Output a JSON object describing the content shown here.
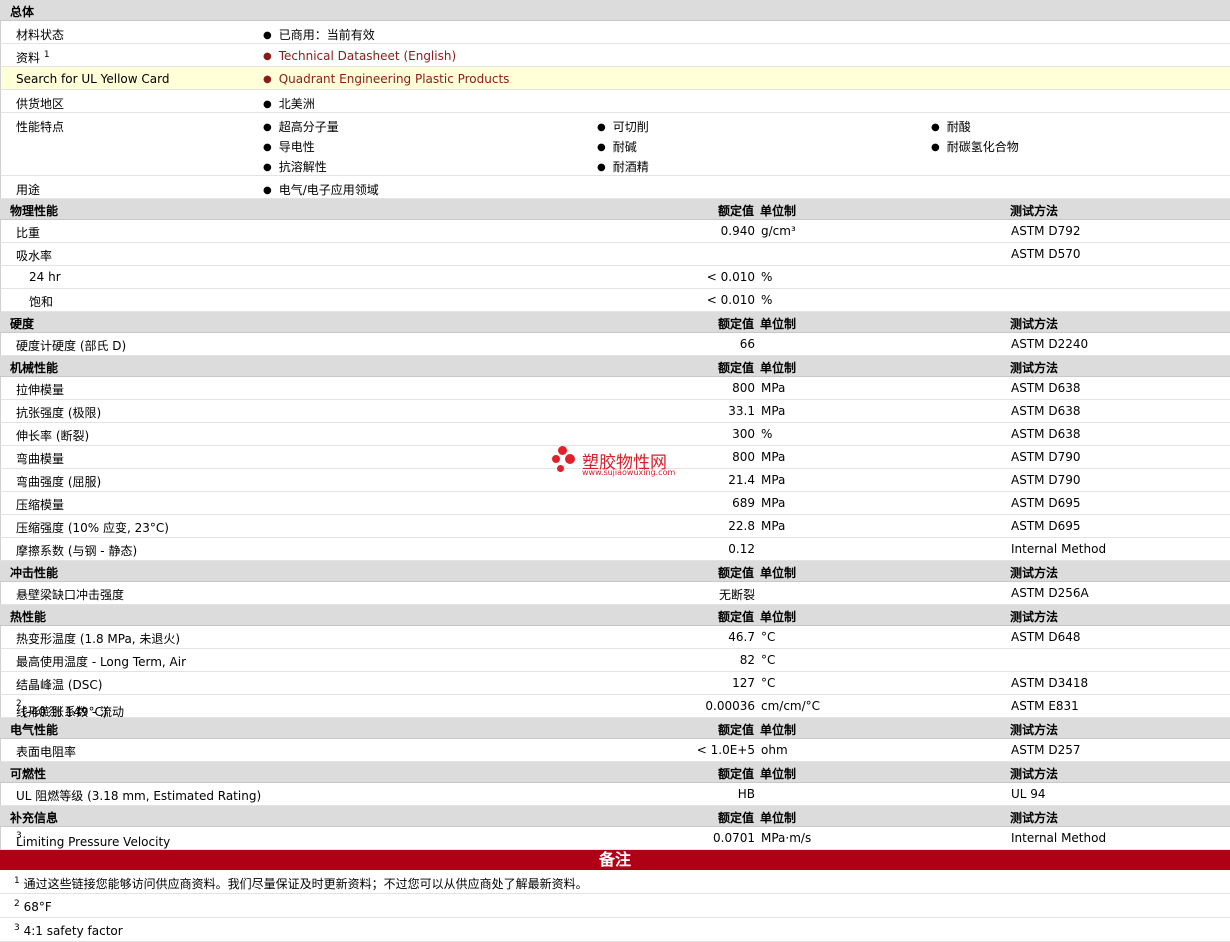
{
  "overview": {
    "title": "总体",
    "status_label": "材料状态",
    "status_value": "已商用：当前有效",
    "doc_label": "资料",
    "doc_sup": "1",
    "doc_link": "Technical Datasheet (English)",
    "ul_label": "Search for UL Yellow Card",
    "ul_link": "Quadrant Engineering Plastic Products",
    "region_label": "供货地区",
    "region_value": "北美洲",
    "features_label": "性能特点",
    "features": [
      "超高分子量",
      "导电性",
      "抗溶解性",
      "可切削",
      "耐碱",
      "耐酒精",
      "耐酸",
      "耐碳氢化合物"
    ],
    "use_label": "用途",
    "use_value": "电气/电子应用领域"
  },
  "columns": {
    "value": "额定值",
    "unit": "单位制",
    "method": "测试方法"
  },
  "sections": {
    "physical": {
      "title": "物理性能",
      "rows": [
        {
          "label": "比重",
          "value": "0.940",
          "unit": "g/cm³",
          "method": "ASTM D792"
        },
        {
          "label": "吸水率",
          "value": "",
          "unit": "",
          "method": "ASTM D570"
        },
        {
          "label": "24 hr",
          "value": "< 0.010",
          "unit": "%",
          "method": ""
        },
        {
          "label": "饱和",
          "value": "< 0.010",
          "unit": "%",
          "method": ""
        }
      ]
    },
    "hardness": {
      "title": "硬度",
      "rows": [
        {
          "label": "硬度计硬度 (部氏 D)",
          "value": "66",
          "unit": "",
          "method": "ASTM D2240"
        }
      ]
    },
    "mechanical": {
      "title": "机械性能",
      "rows": [
        {
          "label": "拉伸模量",
          "value": "800",
          "unit": "MPa",
          "method": "ASTM D638"
        },
        {
          "label": "抗张强度 (极限)",
          "value": "33.1",
          "unit": "MPa",
          "method": "ASTM D638"
        },
        {
          "label": "伸长率 (断裂)",
          "value": "300",
          "unit": "%",
          "method": "ASTM D638"
        },
        {
          "label": "弯曲模量",
          "value": "800",
          "unit": "MPa",
          "method": "ASTM D790"
        },
        {
          "label": "弯曲强度 (屈服)",
          "value": "21.4",
          "unit": "MPa",
          "method": "ASTM D790"
        },
        {
          "label": "压缩模量",
          "value": "689",
          "unit": "MPa",
          "method": "ASTM D695"
        },
        {
          "label": "压缩强度 (10% 应变, 23°C)",
          "value": "22.8",
          "unit": "MPa",
          "method": "ASTM D695"
        },
        {
          "label": "摩擦系数 (与钢 - 静态)",
          "value": "0.12",
          "unit": "",
          "method": "Internal Method"
        }
      ]
    },
    "impact": {
      "title": "冲击性能",
      "rows": [
        {
          "label": "悬壁梁缺口冲击强度",
          "value": "无断裂",
          "unit": "",
          "method": "ASTM D256A"
        }
      ]
    },
    "thermal": {
      "title": "热性能",
      "rows": [
        {
          "label": "热变形温度 (1.8 MPa, 未退火)",
          "value": "46.7",
          "unit": "°C",
          "method": "ASTM D648"
        },
        {
          "label": "最高使用温度 - Long Term, Air",
          "value": "82",
          "unit": "°C",
          "method": ""
        },
        {
          "label": "结晶峰温 (DSC)",
          "value": "127",
          "unit": "°C",
          "method": "ASTM D3418"
        },
        {
          "label": "线形膨胀系数 - 流动",
          "sup": "2",
          "label_tail": " (-40 到 149°C)",
          "value": "0.00036",
          "unit": "cm/cm/°C",
          "method": "ASTM E831"
        }
      ]
    },
    "electrical": {
      "title": "电气性能",
      "rows": [
        {
          "label": "表面电阻率",
          "value": "< 1.0E+5",
          "unit": "ohm",
          "method": "ASTM D257"
        }
      ]
    },
    "flammability": {
      "title": "可燃性",
      "rows": [
        {
          "label": "UL 阻燃等级 (3.18 mm, Estimated Rating)",
          "value": "HB",
          "unit": "",
          "method": "UL 94"
        }
      ]
    },
    "additional": {
      "title": "补充信息",
      "rows": [
        {
          "label": "Limiting Pressure Velocity",
          "sup": "3",
          "value": "0.0701",
          "unit": "MPa·m/s",
          "method": "Internal Method"
        }
      ]
    }
  },
  "notes": {
    "title": "备注",
    "items": [
      {
        "num": "1",
        "text": "通过这些链接您能够访问供应商资料。我们尽量保证及时更新资料；不过您可以从供应商处了解最新资料。"
      },
      {
        "num": "2",
        "text": "68°F"
      },
      {
        "num": "3",
        "text": "4:1 safety factor"
      }
    ]
  },
  "watermark": {
    "name": "塑胶物性网",
    "url": "www.sujiaowuxing.com"
  }
}
